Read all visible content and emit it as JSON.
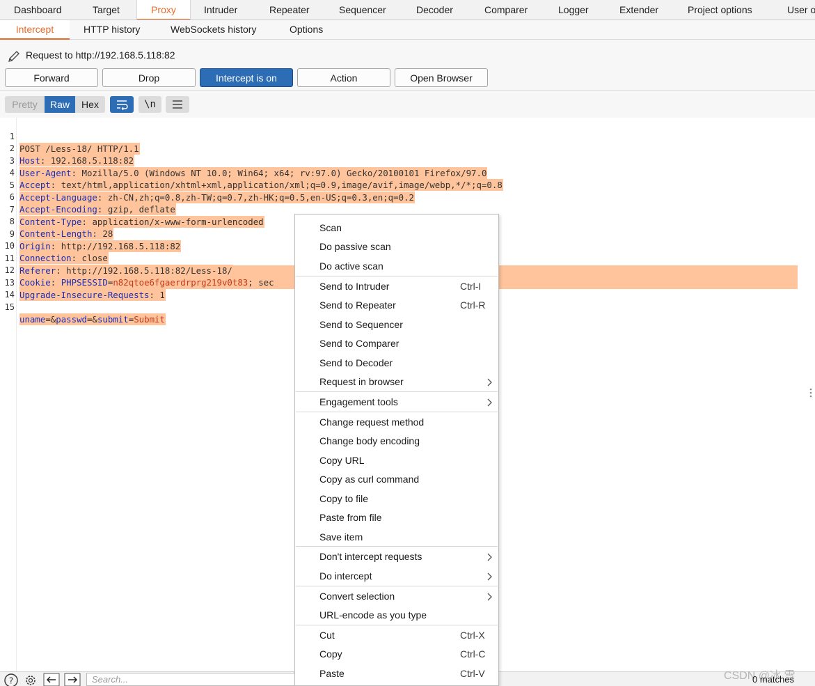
{
  "top_tabs": [
    {
      "label": "Dashboard"
    },
    {
      "label": "Target"
    },
    {
      "label": "Proxy"
    },
    {
      "label": "Intruder"
    },
    {
      "label": "Repeater"
    },
    {
      "label": "Sequencer"
    },
    {
      "label": "Decoder"
    },
    {
      "label": "Comparer"
    },
    {
      "label": "Logger"
    },
    {
      "label": "Extender"
    },
    {
      "label": "Project options"
    },
    {
      "label": "User o"
    }
  ],
  "active_top_tab": "Proxy",
  "sub_tabs": [
    {
      "label": "Intercept"
    },
    {
      "label": "HTTP history"
    },
    {
      "label": "WebSockets history"
    },
    {
      "label": "Options"
    }
  ],
  "active_sub_tab": "Intercept",
  "request_label": "Request to http://192.168.5.118:82",
  "buttons": {
    "forward": "Forward",
    "drop": "Drop",
    "intercept": "Intercept is on",
    "action": "Action",
    "open_browser": "Open Browser"
  },
  "view_modes": {
    "pretty": "Pretty",
    "raw": "Raw",
    "hex": "Hex",
    "selected": "Raw"
  },
  "newline_toggle": "\\n",
  "request_lines": [
    {
      "n": "1",
      "text": "POST /Less-18/ HTTP/1.1"
    },
    {
      "n": "2",
      "key": "Host",
      "value": " 192.168.5.118:82"
    },
    {
      "n": "3",
      "key": "User-Agent",
      "value": " Mozilla/5.0 (Windows NT 10.0; Win64; x64; rv:97.0) Gecko/20100101 Firefox/97.0"
    },
    {
      "n": "4",
      "key": "Accept",
      "value": " text/html,application/xhtml+xml,application/xml;q=0.9,image/avif,image/webp,*/*;q=0.8"
    },
    {
      "n": "5",
      "key": "Accept-Language",
      "value": " zh-CN,zh;q=0.8,zh-TW;q=0.7,zh-HK;q=0.5,en-US;q=0.3,en;q=0.2"
    },
    {
      "n": "6",
      "key": "Accept-Encoding",
      "value": " gzip, deflate"
    },
    {
      "n": "7",
      "key": "Content-Type",
      "value": " application/x-www-form-urlencoded"
    },
    {
      "n": "8",
      "key": "Content-Length",
      "value": " 28"
    },
    {
      "n": "9",
      "key": "Origin",
      "value": " http://192.168.5.118:82"
    },
    {
      "n": "10",
      "key": "Connection",
      "value": " close"
    },
    {
      "n": "11",
      "key": "Referer",
      "value": " http://192.168.5.118:82/Less-18/"
    },
    {
      "n": "12",
      "key": "Cookie",
      "value": " ",
      "cookie_name": "PHPSESSID",
      "cookie_eq": "=",
      "cookie_value": "n82qtoe6fgaerdrprg219v0t83",
      "cookie_tail": "; sec"
    },
    {
      "n": "13",
      "key": "Upgrade-Insecure-Requests",
      "value": " 1"
    },
    {
      "n": "14",
      "text": ""
    },
    {
      "n": "15",
      "body": [
        {
          "name": "uname",
          "value": ""
        },
        {
          "name": "passwd",
          "value": ""
        },
        {
          "name": "submit",
          "value": "Submit"
        }
      ]
    }
  ],
  "search": {
    "placeholder": "Search..."
  },
  "matches": "0 matches",
  "watermark": "CSDN @冰 雪",
  "context_menu": [
    {
      "label": "Scan"
    },
    {
      "label": "Do passive scan"
    },
    {
      "label": "Do active scan"
    },
    {
      "sep": true
    },
    {
      "label": "Send to Intruder",
      "shortcut": "Ctrl-I"
    },
    {
      "label": "Send to Repeater",
      "shortcut": "Ctrl-R"
    },
    {
      "label": "Send to Sequencer"
    },
    {
      "label": "Send to Comparer"
    },
    {
      "label": "Send to Decoder"
    },
    {
      "label": "Request in browser",
      "submenu": true
    },
    {
      "sep": true
    },
    {
      "label": "Engagement tools",
      "submenu": true
    },
    {
      "sep": true
    },
    {
      "label": "Change request method"
    },
    {
      "label": "Change body encoding"
    },
    {
      "label": "Copy URL"
    },
    {
      "label": "Copy as curl command"
    },
    {
      "label": "Copy to file"
    },
    {
      "label": "Paste from file"
    },
    {
      "label": "Save item"
    },
    {
      "sep": true
    },
    {
      "label": "Don't intercept requests",
      "submenu": true
    },
    {
      "label": "Do intercept",
      "submenu": true
    },
    {
      "sep": true
    },
    {
      "label": "Convert selection",
      "submenu": true
    },
    {
      "label": "URL-encode as you type"
    },
    {
      "sep": true
    },
    {
      "label": "Cut",
      "shortcut": "Ctrl-X"
    },
    {
      "label": "Copy",
      "shortcut": "Ctrl-C"
    },
    {
      "label": "Paste",
      "shortcut": "Ctrl-V"
    }
  ],
  "colors": {
    "accent": "#e8692a",
    "primary": "#2d6db5",
    "highlight": "#ffc49b",
    "header_key": "#1a2fb8",
    "param_value": "#c43a1c"
  }
}
